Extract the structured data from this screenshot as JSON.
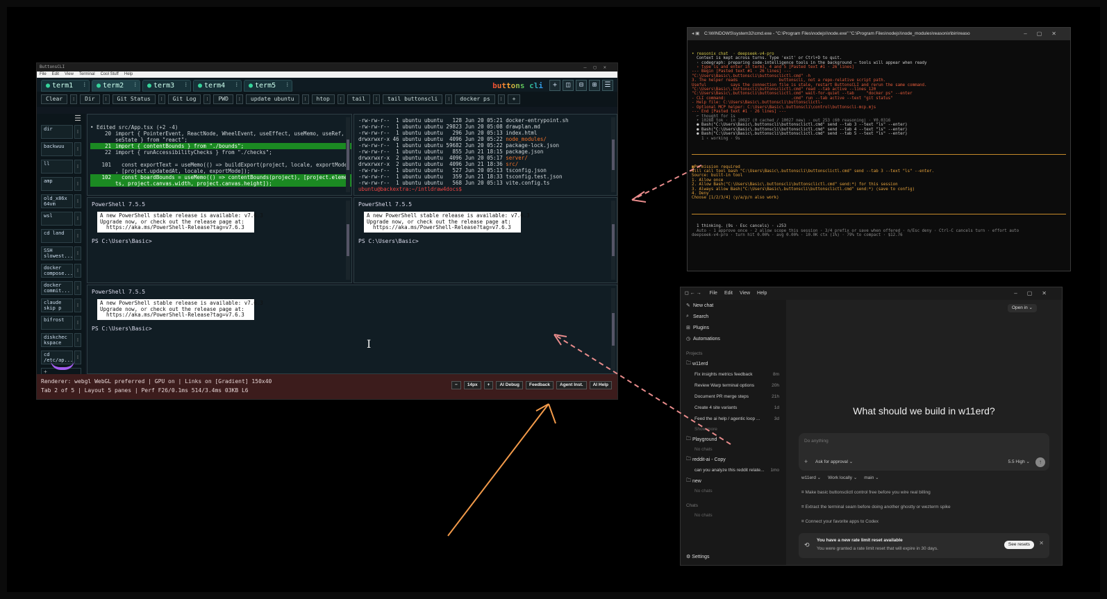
{
  "buttonscli": {
    "title": "ButtonsCLI",
    "menu": [
      "File",
      "Edit",
      "View",
      "Terminal",
      "Cool Stuff",
      "Help"
    ],
    "tabs": [
      "term1",
      "term2",
      "term3",
      "term4",
      "term5"
    ],
    "brand": "buttons cli",
    "commands": [
      "Clear",
      "Dir",
      "Git Status",
      "Git Log",
      "PWD",
      "update ubuntu",
      "htop",
      "tail",
      "tail buttonscli",
      "docker ps",
      "+"
    ],
    "sidebar": [
      "dir",
      "backwuu",
      "ll",
      "amp",
      "old_x86x 64vm",
      "wsl",
      "cd land",
      "SSH slowest...",
      "docker compose...",
      "docker commit...",
      "claude skip p",
      "bifrost",
      "diskchec kspace",
      "cd /etc/ap..."
    ],
    "sidebar_add": "+",
    "diff": {
      "header": "• Edited src/App.tsx (+2 -4)",
      "lines": [
        {
          "n": "20",
          "t": "import { PointerEvent, ReactNode, WheelEvent, useEffect, useMemo, useRef, u",
          "add": false
        },
        {
          "n": "",
          "t": "seState } from \"react\";",
          "add": false
        },
        {
          "n": "21",
          "t": "import { contentBounds } from \"./bounds\";",
          "add": true
        },
        {
          "n": "22",
          "t": "import { runAccessibilityChecks } from \"./checks\";",
          "add": false
        },
        {
          "n": "",
          "t": "",
          "add": false
        },
        {
          "n": "101",
          "t": "  const exportText = useMemo(() => buildExport(project, locale, exportMode)",
          "add": false
        },
        {
          "n": "",
          "t": ", [project.updatedAt, locale, exportMode]);",
          "add": false
        },
        {
          "n": "102",
          "t": "  const boardBounds = useMemo(() => contentBounds(project), [project.elemen",
          "add": true
        },
        {
          "n": "",
          "t": "ts, project.canvas.width, project.canvas.height]);",
          "add": true
        }
      ]
    },
    "ls": [
      {
        "p": "-rw-rw-r--  1 ubuntu ubuntu   128 Jun 20 05:21 ",
        "f": "docker-entrypoint.sh",
        "d": false
      },
      {
        "p": "-rw-rw-r--  1 ubuntu ubuntu 29823 Jun 20 05:08 ",
        "f": "drawplan.md",
        "d": false
      },
      {
        "p": "-rw-rw-r--  1 ubuntu ubuntu   296 Jun 20 05:13 ",
        "f": "index.html",
        "d": false
      },
      {
        "p": "drwxrwxr-x 46 ubuntu ubuntu  4096 Jun 20 05:22 ",
        "f": "node_modules/",
        "d": true
      },
      {
        "p": "-rw-rw-r--  1 ubuntu ubuntu 59682 Jun 20 05:22 ",
        "f": "package-lock.json",
        "d": false
      },
      {
        "p": "-rw-rw-r--  1 ubuntu ubuntu   855 Jun 21 18:15 ",
        "f": "package.json",
        "d": false
      },
      {
        "p": "drwxrwxr-x  2 ubuntu ubuntu  4096 Jun 20 05:17 ",
        "f": "server/",
        "d": true
      },
      {
        "p": "drwxrwxr-x  2 ubuntu ubuntu  4096 Jun 21 18:36 ",
        "f": "src/",
        "d": true
      },
      {
        "p": "-rw-rw-r--  1 ubuntu ubuntu   527 Jun 20 05:13 ",
        "f": "tsconfig.json",
        "d": false
      },
      {
        "p": "-rw-rw-r--  1 ubuntu ubuntu   359 Jun 21 18:33 ",
        "f": "tsconfig.test.json",
        "d": false
      },
      {
        "p": "-rw-rw-r--  1 ubuntu ubuntu   568 Jun 20 05:13 ",
        "f": "vite.config.ts",
        "d": false
      }
    ],
    "ls_prompt": "ubuntu@backextra:~/intldraw4docs$",
    "powershell": {
      "title": "PowerShell 7.5.5",
      "notice": "A new PowerShell stable release is available: v7.6.3\nUpgrade now, or check out the release page at:\n  https://aka.ms/PowerShell-Release?tag=v7.6.3",
      "prompt": "PS C:\\Users\\Basic>"
    },
    "status": {
      "line1": "Renderer: webgl  WebGL preferred | GPU on | Links on [Gradient]  150x40",
      "line2": "Tab 2 of 5 | Layout 5 panes | Perf F26/0.1ms 514/3.4ms 03KB L6",
      "font_size": "14px",
      "buttons": [
        "AI Debug",
        "Feedback",
        "Agent Inst.",
        "AI Help"
      ]
    }
  },
  "cmd_window": {
    "title": "C:\\WINDOWS\\system32\\cmd.exe - \"C:\\Program Files\\nodejs\\\\node.exe\"  \"C:\\Program Files\\nodejs\\\\node_modules\\reasonix\\bin\\reaso",
    "lines": [
      {
        "c": "cy",
        "t": "• reasonix chat  · deepseek-v4-pro"
      },
      {
        "c": "",
        "t": "  Context is kept across turns. Type 'exit' or Ctrl+D to quit."
      },
      {
        "c": "",
        "t": "  · codegraph: preparing code-intelligence tools in the background — tools will appear when ready"
      },
      {
        "c": "",
        "t": ""
      },
      {
        "c": "cr",
        "t": "  › type ls and enter in term3, 4 and 5 [Pasted text #1 · 26 lines]"
      },
      {
        "c": "",
        "t": ""
      },
      {
        "c": "cr",
        "t": "--- Begin [Pasted text #1 · 26 lines] ---"
      },
      {
        "c": "cr",
        "t": "\"C:\\Users\\Basic\\.buttonscli\\buttonsclictl.cmd\" -h"
      },
      {
        "c": "cr",
        "t": "3. The helper reads                 buttonscli, not a repo-relative script path."
      },
      {
        "c": "cr",
        "t": "Useful          says the connection file is stale, restart ButtonsCLI and rerun the same command."
      },
      {
        "c": "cr",
        "t": "\"C:\\Users\\Basic\\.buttonscli\\buttonsclictl.cmd\" read --tab active --lines 120"
      },
      {
        "c": "cr",
        "t": "\"C:\\Users\\Basic\\.buttonscli\\buttonsclictl.cmd\" wait-for-quiet --tab     \"docker ps\" --enter"
      },
      {
        "c": "cr",
        "t": "- CLI command:                           .cmd\" run --tab active --text \"git status\""
      },
      {
        "c": "cr",
        "t": "- Help file: C:\\Users\\Basic\\.buttonscli\\buttonsclictl-"
      },
      {
        "c": "cr",
        "t": "- Optional MCP helper: C:\\Users\\Basic\\.buttonscli\\control\\buttonscli-mcp.mjs"
      },
      {
        "c": "cr",
        "t": "--- End [Pasted text #1 · 26 lines] ---"
      },
      {
        "c": "",
        "t": ""
      },
      {
        "c": "cg",
        "t": "  ⌐ thought for 1s"
      },
      {
        "c": "cg",
        "t": "  ‣ 10288 tok · in 10027 (0 cached / 10027 new) · out 253 (60 reasoning) · ¥0.0316"
      },
      {
        "c": "",
        "t": ""
      },
      {
        "c": "",
        "t": "  ● Bash(\"C:\\Users\\Basic\\.buttonscli\\buttonsclictl.cmd\" send --tab 3 --text \"ls\" --enter)"
      },
      {
        "c": "",
        "t": ""
      },
      {
        "c": "",
        "t": "  ● Bash(\"C:\\Users\\Basic\\.buttonscli\\buttonsclictl.cmd\" send --tab 4 --text \"ls\" --enter)"
      },
      {
        "c": "",
        "t": ""
      },
      {
        "c": "",
        "t": "  ● Bash(\"C:\\Users\\Basic\\.buttonscli\\buttonsclictl.cmd\" send --tab 5 --text \"ls\" --enter)"
      },
      {
        "c": "cg",
        "t": "    1 ‹ working · 9s"
      }
    ],
    "perm_lines": [
      {
        "c": "co",
        "t": "▣Permission required"
      },
      {
        "c": "",
        "t": ""
      },
      {
        "c": "co",
        "t": "Will call tool bash \"C:\\Users\\Basic\\.buttonscli\\buttonsclictl.cmd\" send --tab 3 --text \"ls\" --enter."
      },
      {
        "c": "co",
        "t": "Source: built-in tool"
      },
      {
        "c": "co",
        "t": "1. Allow once"
      },
      {
        "c": "co",
        "t": "2. Allow Bash(\"C:\\Users\\Basic\\.buttonscli\\buttonsclictl.cmd\" send:*) for this session"
      },
      {
        "c": "co",
        "t": "3. Always allow Bash(\"C:\\Users\\Basic\\.buttonscli\\buttonsclictl.cmd\" send:*) (save to config)"
      },
      {
        "c": "co",
        "t": "4. Deny"
      },
      {
        "c": "co",
        "t": "Choose [1/2/3/4] (y/a/p/n also work)"
      }
    ],
    "footer": [
      {
        "c": "",
        "t": "  1 thinking. (9s · Esc cancels) · ↓253"
      },
      {
        "c": "cg",
        "t": "  Auto · 1 approve once · 2 allow scope this session · 3/4 prefix or save when offered · n/Esc deny · Ctrl-C cancels turn · effort auto"
      },
      {
        "c": "cg",
        "t": "deepseek-v4-pro · turn hit 0.00% · avg 0.00% · 10.0K ctx (1%) · 79% to compact · $12.76"
      }
    ]
  },
  "codex": {
    "menu": [
      "File",
      "Edit",
      "View",
      "Help"
    ],
    "nav": [
      {
        "icon": "✎",
        "label": "New chat"
      },
      {
        "icon": "⌕",
        "label": "Search"
      },
      {
        "icon": "⊞",
        "label": "Plugins"
      },
      {
        "icon": "◷",
        "label": "Automations"
      }
    ],
    "projects_label": "Projects",
    "project1": "w11erd",
    "project1_items": [
      {
        "t": "Fix insights metrics feedback",
        "time": "8m"
      },
      {
        "t": "Review Warp terminal options",
        "time": "20h"
      },
      {
        "t": "Document PR merge steps",
        "time": "21h"
      },
      {
        "t": "Create 4 site variants",
        "time": "1d"
      },
      {
        "t": "Feed the ai help / agentic loop ...",
        "time": "3d"
      }
    ],
    "show_more": "Show more",
    "project2": "Playground",
    "no_chats": "No chats",
    "project3": "reddit-ai - Copy",
    "project3_item": {
      "t": "can you analyze this reddit relate...",
      "time": "1mo"
    },
    "project4": "new",
    "chats_label": "Chats",
    "settings": "Settings",
    "open_in": "Open in",
    "heading": "What should we build in w11erd?",
    "placeholder": "Do anything",
    "approval": "Ask for approval ⌄",
    "model": "5.5 High ⌄",
    "opts": [
      "w11erd ⌄",
      "Work locally ⌄",
      "main ⌄"
    ],
    "suggestions": [
      "Make basic buttonsclictl control free before you wire real billing",
      "Extract the terminal seam before doing another ghostty or wezterm spike",
      "Connect your favorite apps to Codex"
    ],
    "toast_title": "You have a new rate limit reset available",
    "toast_body": "You were granted a rate limit reset that will expire in 30 days.",
    "toast_btn": "See resets"
  }
}
